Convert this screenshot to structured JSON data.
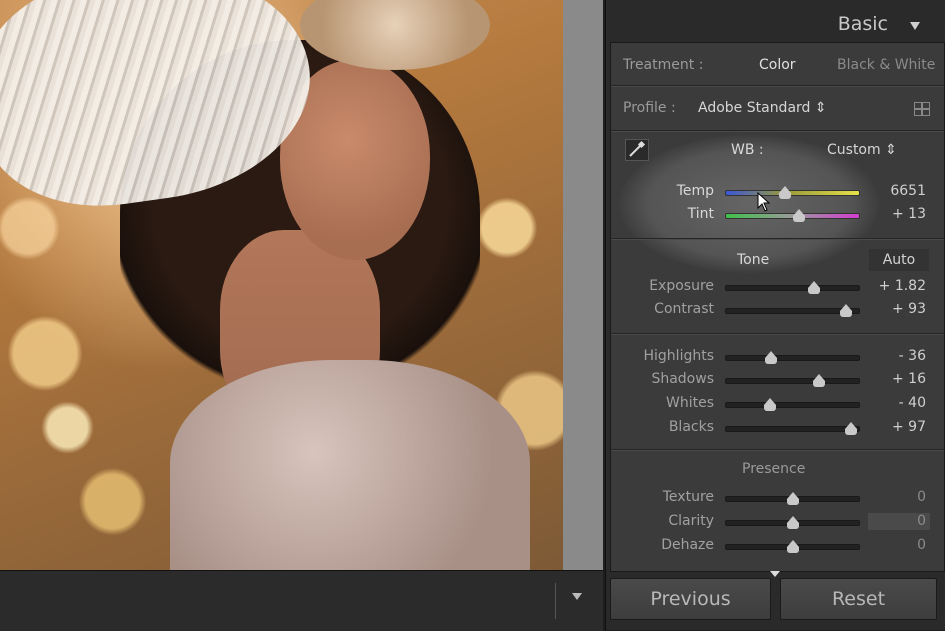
{
  "panel": {
    "title": "Basic",
    "treatment": {
      "label": "Treatment :",
      "options": [
        "Color",
        "Black & White"
      ],
      "selected": "Color"
    },
    "profile": {
      "label": "Profile :",
      "value": "Adobe Standard ⇕"
    },
    "wb": {
      "label": "WB :",
      "value": "Custom ⇕"
    },
    "sliders_wb": [
      {
        "label": "Temp",
        "value": "6651",
        "position": 0.44
      },
      {
        "label": "Tint",
        "value": "+ 13",
        "position": 0.55
      }
    ],
    "tone": {
      "label": "Tone",
      "auto_label": "Auto"
    },
    "sliders_tone": [
      {
        "label": "Exposure",
        "value": "+ 1.82",
        "position": 0.66
      },
      {
        "label": "Contrast",
        "value": "+ 93",
        "position": 0.9
      }
    ],
    "sliders_tone2": [
      {
        "label": "Highlights",
        "value": "- 36",
        "position": 0.34
      },
      {
        "label": "Shadows",
        "value": "+ 16",
        "position": 0.7
      },
      {
        "label": "Whites",
        "value": "- 40",
        "position": 0.33
      },
      {
        "label": "Blacks",
        "value": "+ 97",
        "position": 0.94
      }
    ],
    "presence": {
      "label": "Presence"
    },
    "sliders_presence": [
      {
        "label": "Texture",
        "value": "0",
        "position": 0.5
      },
      {
        "label": "Clarity",
        "value": "0",
        "position": 0.5
      },
      {
        "label": "Dehaze",
        "value": "0",
        "position": 0.5
      }
    ],
    "buttons": {
      "previous": "Previous",
      "reset": "Reset"
    }
  },
  "icons": {
    "eyedropper": "eyedropper-icon",
    "profile_grid": "grid-icon",
    "collapse": "triangle-down-icon",
    "toolbar_menu": "triangle-down-icon"
  },
  "colors": {
    "panel_bg": "#3b3b3b",
    "temp_gradient": [
      "#3a57d8",
      "#e6e04a"
    ],
    "tint_gradient": [
      "#3fc04a",
      "#d23dd0"
    ]
  }
}
